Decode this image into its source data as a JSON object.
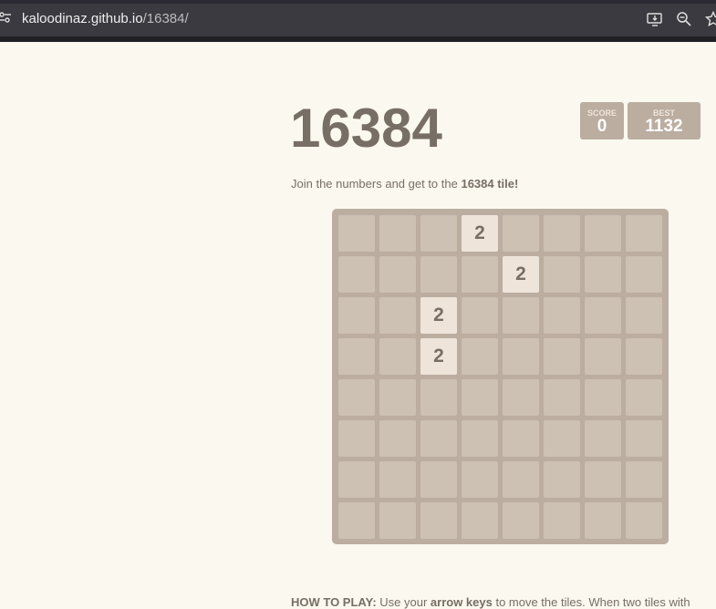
{
  "browser": {
    "url_host": "kaloodinaz.github.io",
    "url_path": "/16384/",
    "icons": [
      "site-info-icon",
      "install-app-icon",
      "zoom-out-icon",
      "bookmark-star-icon"
    ]
  },
  "header": {
    "title": "16384",
    "score_label": "SCORE",
    "score_value": "0",
    "best_label": "BEST",
    "best_value": "1132"
  },
  "intro": {
    "prefix": "Join the numbers and get to the ",
    "emphasis": "16384 tile!"
  },
  "board": {
    "size": 8,
    "tiles": [
      {
        "row": 0,
        "col": 3,
        "value": "2"
      },
      {
        "row": 1,
        "col": 4,
        "value": "2"
      },
      {
        "row": 2,
        "col": 2,
        "value": "2"
      },
      {
        "row": 3,
        "col": 2,
        "value": "2"
      }
    ]
  },
  "howto": {
    "label": "HOW TO PLAY:",
    "text1": " Use your ",
    "keys": "arrow keys",
    "text2": " to move the tiles. When two tiles with"
  },
  "colors": {
    "background": "#faf8ef",
    "grid": "#bbada0",
    "cell": "#cdc1b4",
    "tile_2": "#eee4da",
    "text": "#776e65"
  }
}
